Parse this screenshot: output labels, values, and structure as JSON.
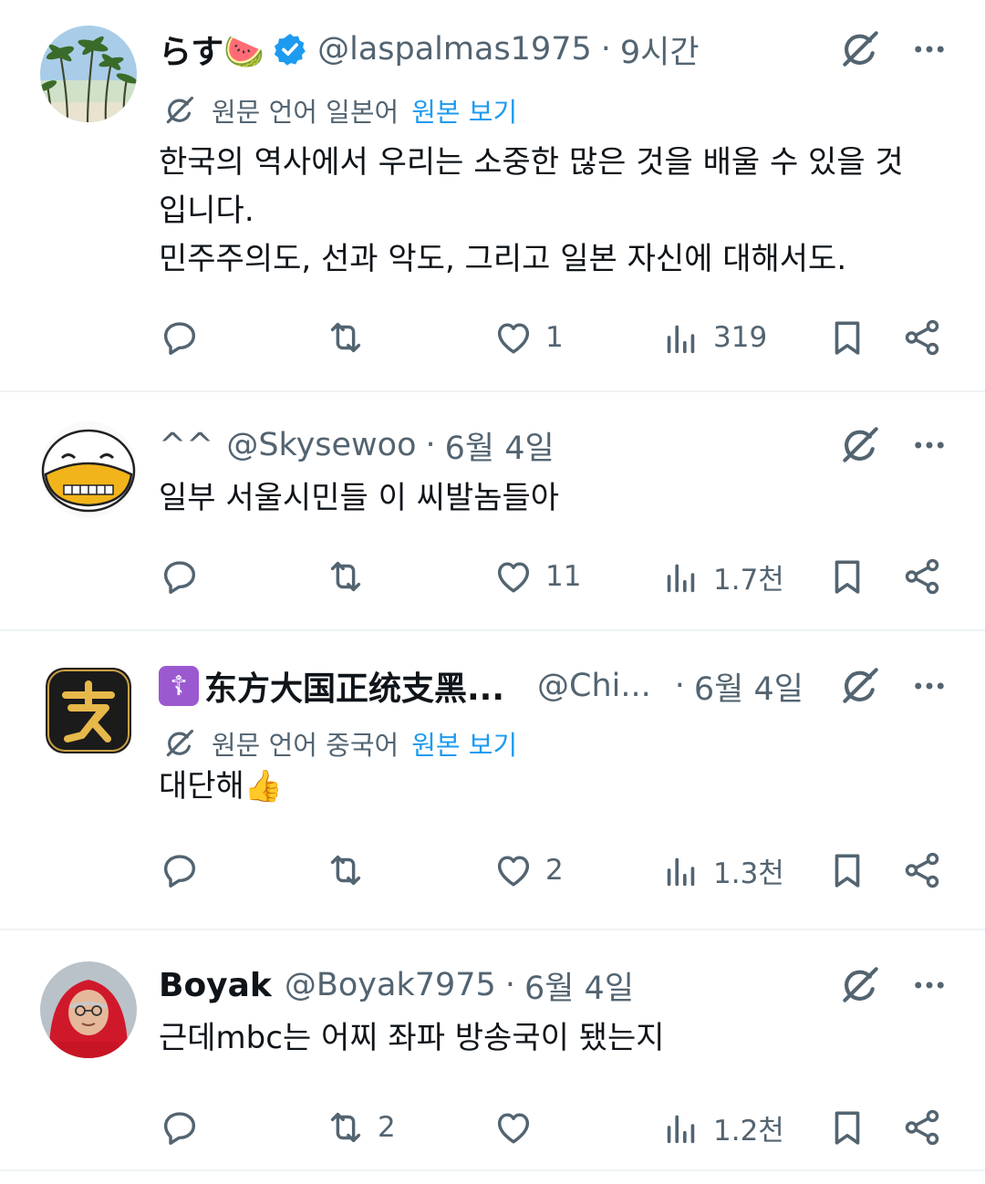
{
  "tweets": [
    {
      "name": "らす🍉",
      "verified": true,
      "handle": "@laspalmas1975",
      "time": "9시간",
      "translation": {
        "prefix": "원문 언어 일본어",
        "link": "원본 보기"
      },
      "text": "한국의 역사에서 우리는 소중한 많은 것을 배울 수 있을 것\n입니다.\n민주주의도, 선과 악도, 그리고 일본 자신에 대해서도.",
      "likes": "1",
      "retweets": "",
      "views": "319"
    },
    {
      "name": "^^",
      "verified": false,
      "handle": "@Skysewoo",
      "time": "6월 4일",
      "text": "일부 서울시민들 이 씨발놈들아",
      "likes": "11",
      "retweets": "",
      "views": "1.7천"
    },
    {
      "name_badge": "☦",
      "name": "东方大国正统支黑...",
      "verified": false,
      "handle": "@Chi...",
      "time": "6월 4일",
      "translation": {
        "prefix": "원문 언어 중국어",
        "link": "원본 보기"
      },
      "text": "대단해👍",
      "likes": "2",
      "retweets": "",
      "views": "1.3천"
    },
    {
      "name": "Boyak",
      "verified": false,
      "handle": "@Boyak7975",
      "time": "6월 4일",
      "text": "근데mbc는 어찌 좌파 방송국이 됐는지",
      "likes": "",
      "retweets": "2",
      "views": "1.2천"
    }
  ],
  "colors": {
    "text": "#0f1419",
    "secondary": "#536471",
    "link": "#1d9bf0",
    "verified": "#1d9bf0",
    "divider": "#eff3f4"
  },
  "icons": [
    "reply-icon",
    "retweet-icon",
    "like-icon",
    "views-icon",
    "bookmark-icon",
    "share-icon",
    "grok-icon",
    "more-icon",
    "verified-icon",
    "translate-icon"
  ]
}
